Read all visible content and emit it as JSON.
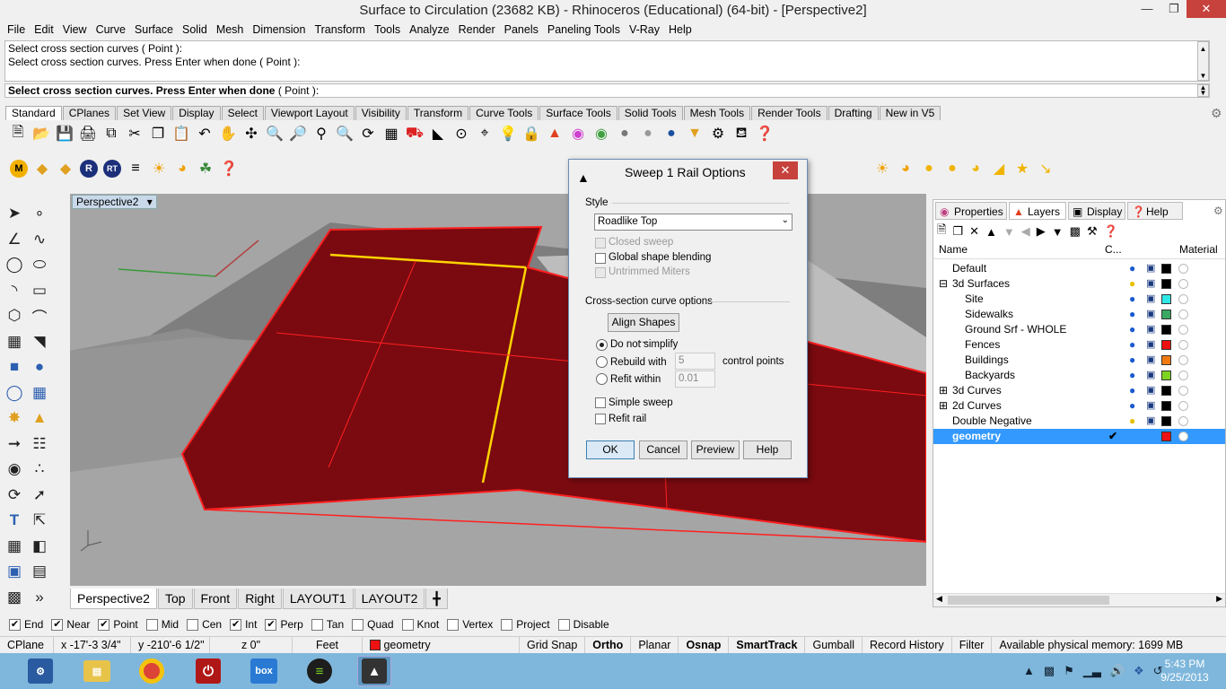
{
  "window": {
    "title": "Surface to Circulation (23682 KB) - Rhinoceros (Educational) (64-bit) - [Perspective2]"
  },
  "menu": [
    "File",
    "Edit",
    "View",
    "Curve",
    "Surface",
    "Solid",
    "Mesh",
    "Dimension",
    "Transform",
    "Tools",
    "Analyze",
    "Render",
    "Panels",
    "Paneling Tools",
    "V-Ray",
    "Help"
  ],
  "command": {
    "history": [
      "Select cross section curves ( Point ):",
      "Select cross section curves. Press Enter when done ( Point ):"
    ],
    "prompt": "Select cross section curves. Press Enter when done",
    "prompt_opt": "( Point ):"
  },
  "toolbar_tabs": [
    "Standard",
    "CPlanes",
    "Set View",
    "Display",
    "Select",
    "Viewport Layout",
    "Visibility",
    "Transform",
    "Curve Tools",
    "Surface Tools",
    "Solid Tools",
    "Mesh Tools",
    "Render Tools",
    "Drafting",
    "New in V5"
  ],
  "viewport": {
    "label": "Perspective2"
  },
  "viewport_tabs": [
    "Perspective2",
    "Top",
    "Front",
    "Right",
    "LAYOUT1",
    "LAYOUT2"
  ],
  "dialog": {
    "title": "Sweep 1 Rail Options",
    "style_label": "Style",
    "style_value": "Roadlike Top",
    "closed_sweep": "Closed sweep",
    "global_blend": "Global shape blending",
    "untrimmed": "Untrimmed Miters",
    "cross_section_label": "Cross-section curve options",
    "align_shapes": "Align Shapes ...",
    "do_not_simplify": "Do not simplify",
    "rebuild_with": "Rebuild with",
    "rebuild_value": "5",
    "control_points": "control points",
    "refit_within": "Refit within",
    "refit_value": "0.01",
    "simple_sweep": "Simple sweep",
    "refit_rail": "Refit rail",
    "ok": "OK",
    "cancel": "Cancel",
    "preview": "Preview",
    "help": "Help"
  },
  "panel_tabs": [
    "Properties",
    "Layers",
    "Display",
    "Help"
  ],
  "layers_header": {
    "name": "Name",
    "current": "C...",
    "material": "Material"
  },
  "layers": [
    {
      "name": "Default",
      "indent": 0,
      "color": "#000000"
    },
    {
      "name": "3d Surfaces",
      "indent": 0,
      "expand": "⊟",
      "color": "#000000"
    },
    {
      "name": "Site",
      "indent": 1,
      "color": "#2ee8e8"
    },
    {
      "name": "Sidewalks",
      "indent": 1,
      "color": "#3aa860"
    },
    {
      "name": "Ground Srf - WHOLE",
      "indent": 1,
      "color": "#000000"
    },
    {
      "name": "Fences",
      "indent": 1,
      "color": "#ee1111"
    },
    {
      "name": "Buildings",
      "indent": 1,
      "color": "#f07a10"
    },
    {
      "name": "Backyards",
      "indent": 1,
      "color": "#7ed321"
    },
    {
      "name": "3d Curves",
      "indent": 0,
      "expand": "⊞",
      "color": "#000000"
    },
    {
      "name": "2d Curves",
      "indent": 0,
      "expand": "⊞",
      "color": "#000000"
    },
    {
      "name": "Double Negative",
      "indent": 0,
      "color": "#000000"
    },
    {
      "name": "geometry",
      "indent": 0,
      "color": "#ee1111",
      "selected": true
    }
  ],
  "osnaps": [
    {
      "label": "End",
      "on": true
    },
    {
      "label": "Near",
      "on": true
    },
    {
      "label": "Point",
      "on": true
    },
    {
      "label": "Mid",
      "on": false
    },
    {
      "label": "Cen",
      "on": false
    },
    {
      "label": "Int",
      "on": true
    },
    {
      "label": "Perp",
      "on": true
    },
    {
      "label": "Tan",
      "on": false
    },
    {
      "label": "Quad",
      "on": false
    },
    {
      "label": "Knot",
      "on": false
    },
    {
      "label": "Vertex",
      "on": false
    },
    {
      "label": "Project",
      "on": false
    },
    {
      "label": "Disable",
      "on": false
    }
  ],
  "status": {
    "cplane": "CPlane",
    "x": "x -17'-3 3/4\"",
    "y": "y -210'-6 1/2\"",
    "z": "z 0\"",
    "units": "Feet",
    "layer": "geometry",
    "grid_snap": "Grid Snap",
    "ortho": "Ortho",
    "planar": "Planar",
    "osnap": "Osnap",
    "smarttrack": "SmartTrack",
    "gumball": "Gumball",
    "record_history": "Record History",
    "filter": "Filter",
    "memory": "Available physical memory: 1699 MB"
  },
  "clock": {
    "time": "5:43 PM",
    "date": "9/25/2013"
  },
  "colors": {
    "surface": "#7a0a10",
    "edge": "#ff2020",
    "highlight": "#ffd400",
    "viewport_bg": "#a5a5a5",
    "taskbar": "#7fb7dc",
    "layer_selected": "#3399ff"
  }
}
